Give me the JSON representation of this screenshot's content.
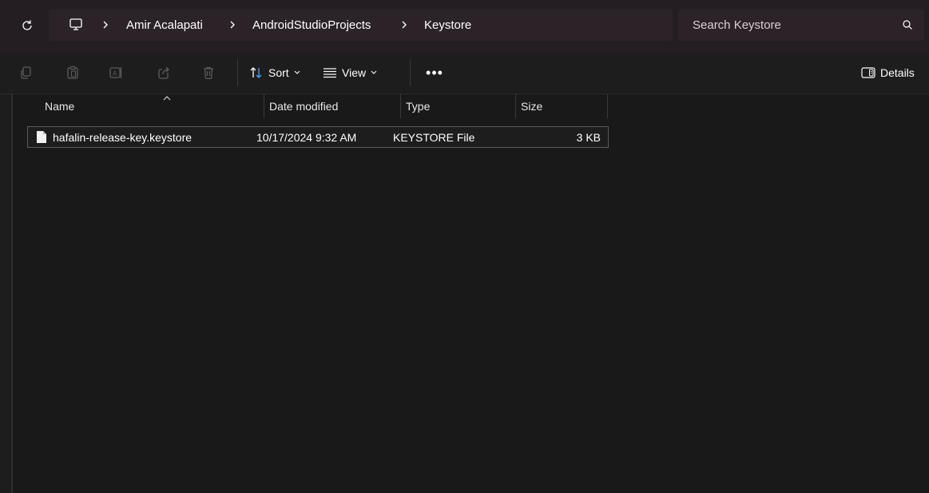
{
  "address_bar": {
    "breadcrumbs": [
      "Amir Acalapati",
      "AndroidStudioProjects",
      "Keystore"
    ]
  },
  "search": {
    "placeholder": "Search Keystore"
  },
  "command_bar": {
    "sort_label": "Sort",
    "view_label": "View",
    "more_label": "•••",
    "details_label": "Details"
  },
  "columns": {
    "name": "Name",
    "date": "Date modified",
    "type": "Type",
    "size": "Size"
  },
  "files": [
    {
      "name": "hafalin-release-key.keystore",
      "date": "10/17/2024 9:32 AM",
      "type": "KEYSTORE File",
      "size": "3 KB"
    }
  ],
  "colors": {
    "title_bar": "#241d22",
    "address_field": "#2c2329",
    "background": "#191919"
  },
  "icons": [
    "refresh-icon",
    "this-pc-icon",
    "chevron-right-icon",
    "search-icon",
    "copy-icon",
    "paste-icon",
    "rename-icon",
    "share-icon",
    "delete-icon",
    "sort-icon",
    "view-icon",
    "details-pane-icon",
    "file-icon",
    "sort-ascending-icon"
  ]
}
